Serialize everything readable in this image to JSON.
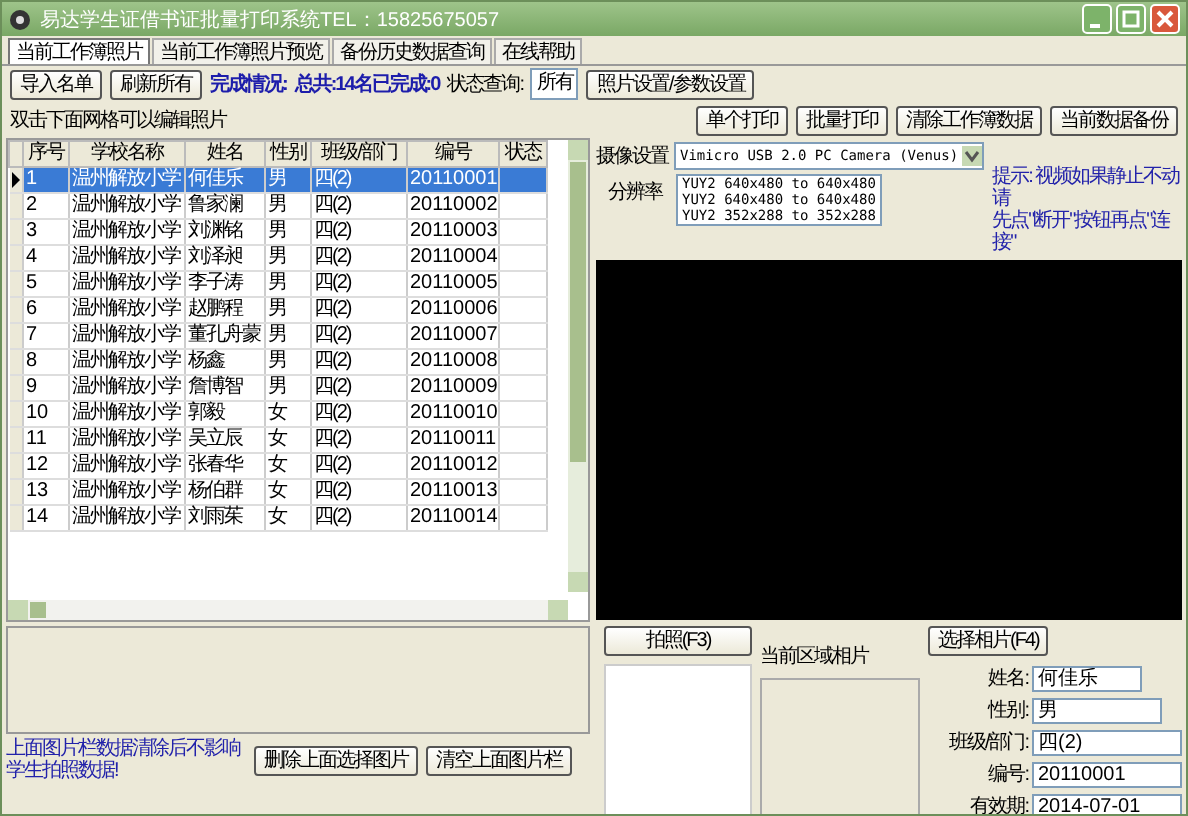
{
  "window": {
    "title": "易达学生证借书证批量打印系统TEL：15825675057"
  },
  "tabs": [
    {
      "label": "当前工作簿照片",
      "selected": true
    },
    {
      "label": "当前工作簿照片预览",
      "selected": false
    },
    {
      "label": "备份历史数据查询",
      "selected": false
    },
    {
      "label": "在线帮助",
      "selected": false
    }
  ],
  "toolbar": {
    "import_button": "导入名单",
    "refresh_button": "刷新所有",
    "status_label": "完成情况:",
    "status_value": "总共:14名已完成:0",
    "filter_label": "状态查询:",
    "filter_value": "所有",
    "photo_settings_button": "照片设置/参数设置",
    "print_one_button": "单个打印",
    "batch_print_button": "批量打印",
    "clear_button": "清除工作簿数据",
    "backup_button": "当前数据备份"
  },
  "grid_hint": "双击下面网格可以编辑照片",
  "table": {
    "columns": [
      "序号",
      "学校名称",
      "姓名",
      "性别",
      "班级/部门",
      "编号",
      "状态"
    ],
    "rows": [
      {
        "cells": [
          "1",
          "温州解放小学",
          "何佳乐",
          "男",
          "四(2)",
          "20110001",
          ""
        ],
        "selected": true
      },
      {
        "cells": [
          "2",
          "温州解放小学",
          "鲁家澜",
          "男",
          "四(2)",
          "20110002",
          ""
        ],
        "selected": false
      },
      {
        "cells": [
          "3",
          "温州解放小学",
          "刘渊铭",
          "男",
          "四(2)",
          "20110003",
          ""
        ],
        "selected": false
      },
      {
        "cells": [
          "4",
          "温州解放小学",
          "刘泽昶",
          "男",
          "四(2)",
          "20110004",
          ""
        ],
        "selected": false
      },
      {
        "cells": [
          "5",
          "温州解放小学",
          "李子涛",
          "男",
          "四(2)",
          "20110005",
          ""
        ],
        "selected": false
      },
      {
        "cells": [
          "6",
          "温州解放小学",
          "赵鹏程",
          "男",
          "四(2)",
          "20110006",
          ""
        ],
        "selected": false
      },
      {
        "cells": [
          "7",
          "温州解放小学",
          "董孔舟蒙",
          "男",
          "四(2)",
          "20110007",
          ""
        ],
        "selected": false
      },
      {
        "cells": [
          "8",
          "温州解放小学",
          "杨鑫",
          "男",
          "四(2)",
          "20110008",
          ""
        ],
        "selected": false
      },
      {
        "cells": [
          "9",
          "温州解放小学",
          "詹博智",
          "男",
          "四(2)",
          "20110009",
          ""
        ],
        "selected": false
      },
      {
        "cells": [
          "10",
          "温州解放小学",
          "郭毅",
          "女",
          "四(2)",
          "20110010",
          ""
        ],
        "selected": false
      },
      {
        "cells": [
          "11",
          "温州解放小学",
          "吴立辰",
          "女",
          "四(2)",
          "20110011",
          ""
        ],
        "selected": false
      },
      {
        "cells": [
          "12",
          "温州解放小学",
          "张春华",
          "女",
          "四(2)",
          "20110012",
          ""
        ],
        "selected": false
      },
      {
        "cells": [
          "13",
          "温州解放小学",
          "杨伯群",
          "女",
          "四(2)",
          "20110013",
          ""
        ],
        "selected": false
      },
      {
        "cells": [
          "14",
          "温州解放小学",
          "刘雨茱",
          "女",
          "四(2)",
          "20110014",
          ""
        ],
        "selected": false
      }
    ]
  },
  "bottom": {
    "note": "上面图片栏数据清除后不影响学生拍照数据!",
    "delete_button": "删除上面选择图片",
    "clear_button": "清空上面图片栏"
  },
  "camera": {
    "device_label": "摄像设置",
    "device": "Vimicro USB 2.0 PC Camera (Venus)",
    "resolution_label": "分辨率",
    "resolutions": [
      "YUY2 640x480 to 640x480",
      "YUY2 640x480 to 640x480",
      "YUY2 352x288 to 352x288"
    ],
    "tip": [
      "提示: 视频如果静止不动请",
      "先点\"断开\"按钮再点\"连接\""
    ]
  },
  "capture_button": "拍照(F3)",
  "current_photo_label": "当前区域相片",
  "select_photo_button": "选择相片(F4)",
  "fields": [
    {
      "label": "姓名:",
      "value": "何佳乐"
    },
    {
      "label": "性别:",
      "value": "男"
    },
    {
      "label": "班级/部门:",
      "value": "四(2)"
    },
    {
      "label": "编号:",
      "value": "20110001"
    },
    {
      "label": "有效期:",
      "value": "2014-07-01"
    }
  ]
}
